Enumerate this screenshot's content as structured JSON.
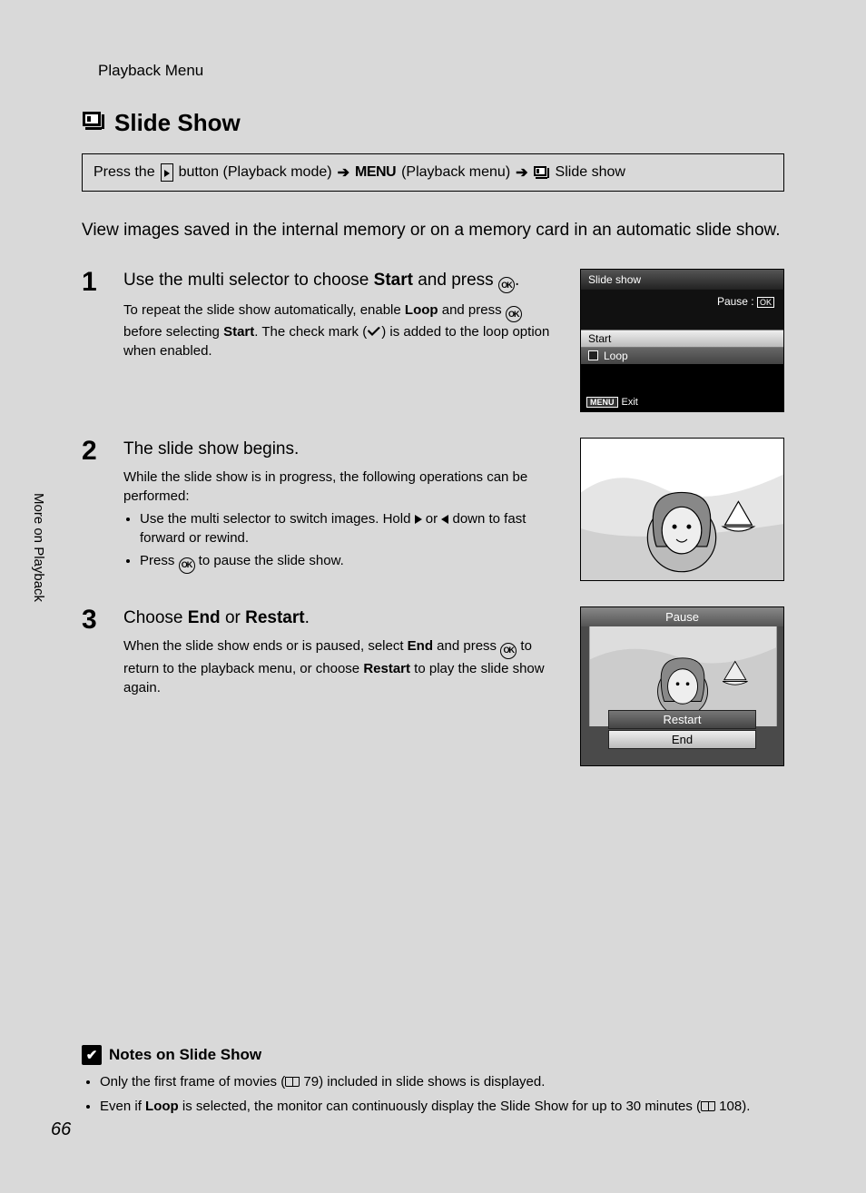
{
  "breadcrumb": "Playback Menu",
  "side_label": "More on Playback",
  "page_number": "66",
  "title": "Slide Show",
  "nav": {
    "press_the": "Press the",
    "button_label": "button (Playback mode)",
    "menu_label": "(Playback menu)",
    "slide_label": "Slide show",
    "menu_word": "MENU"
  },
  "intro": "View images saved in the internal memory or on a memory card in an automatic slide show.",
  "steps": [
    {
      "num": "1",
      "heading_pre": "Use the multi selector to choose ",
      "heading_bold": "Start",
      "heading_post": " and press ",
      "detail_a": "To repeat the slide show automatically, enable ",
      "detail_b": "Loop",
      "detail_c": " and press ",
      "detail_d": " before selecting ",
      "detail_e": "Start",
      "detail_f": ". The check mark (",
      "detail_g": ") is added to the loop option when enabled."
    },
    {
      "num": "2",
      "heading": "The slide show begins.",
      "detail_intro": "While the slide show is in progress, the following operations can be performed:",
      "bullet1_a": "Use the multi selector to switch images. Hold ",
      "bullet1_b": " or ",
      "bullet1_c": " down to fast forward or rewind.",
      "bullet2_a": "Press ",
      "bullet2_b": " to pause the slide show."
    },
    {
      "num": "3",
      "heading_pre": "Choose ",
      "heading_b1": "End",
      "heading_mid": " or ",
      "heading_b2": "Restart",
      "heading_post": ".",
      "detail_a": "When the slide show ends or is paused, select ",
      "detail_b": "End",
      "detail_c": " and press ",
      "detail_d": " to return to the playback menu, or choose ",
      "detail_e": "Restart",
      "detail_f": " to play the slide show again."
    }
  ],
  "lcd1": {
    "title": "Slide show",
    "pause": "Pause :",
    "start": "Start",
    "loop": "Loop",
    "exit": "Exit",
    "menu": "MENU"
  },
  "lcd3": {
    "pause": "Pause",
    "restart": "Restart",
    "end": "End"
  },
  "notes": {
    "title": "Notes on Slide Show",
    "b1_a": "Only the first frame of movies (",
    "b1_ref": " 79",
    "b1_b": ") included in slide shows is displayed.",
    "b2_a": "Even if ",
    "b2_bold": "Loop",
    "b2_b": " is selected, the monitor can continuously display the Slide Show for up to 30 minutes (",
    "b2_ref": " 108",
    "b2_c": ")."
  }
}
